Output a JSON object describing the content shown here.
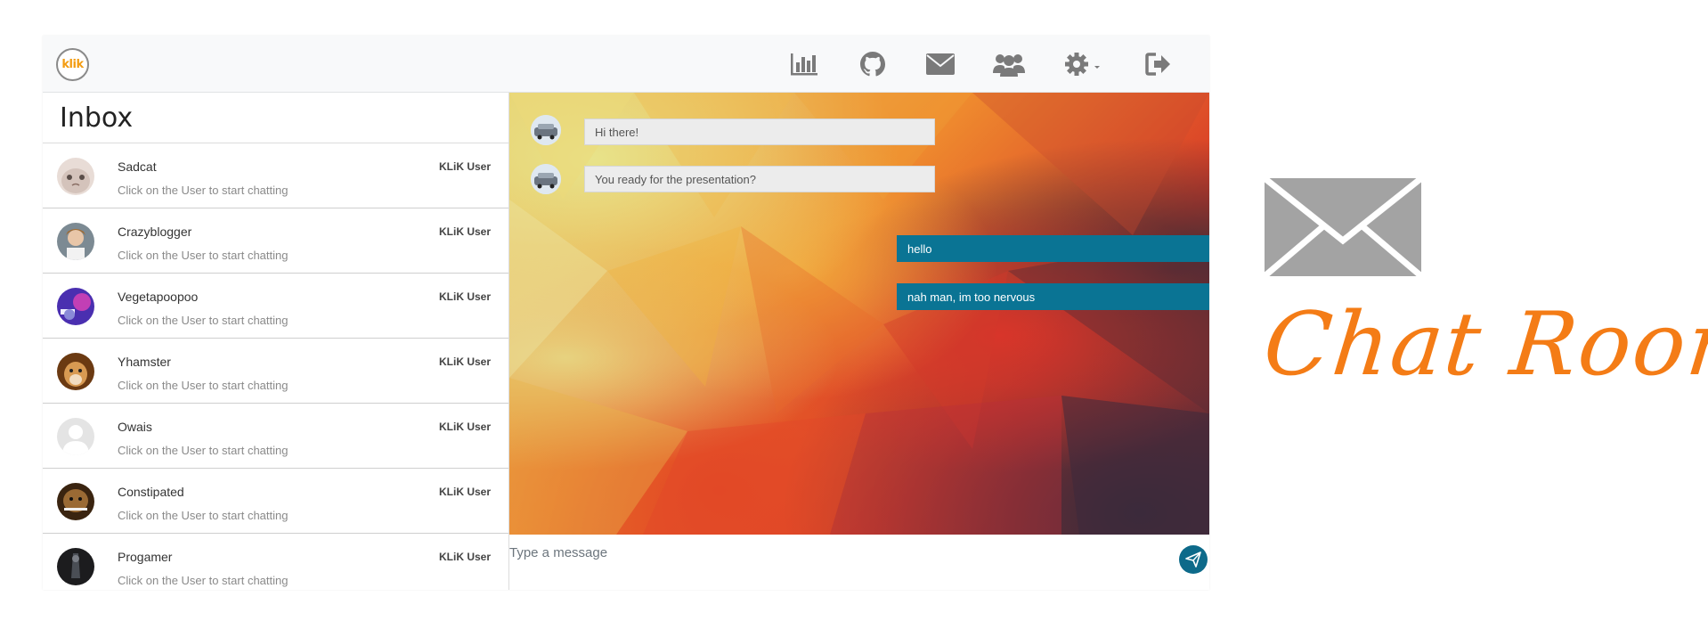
{
  "app": {
    "logo_text": "klik"
  },
  "topbar": {
    "icons": [
      "bar-chart-icon",
      "github-icon",
      "envelope-icon",
      "users-icon",
      "gear-icon",
      "sign-out-icon"
    ]
  },
  "sidebar": {
    "title": "Inbox",
    "users": [
      {
        "name": "Sadcat",
        "hint": "Click on the User to start chatting",
        "badge": "KLiK User"
      },
      {
        "name": "Crazyblogger",
        "hint": "Click on the User to start chatting",
        "badge": "KLiK User"
      },
      {
        "name": "Vegetapoopoo",
        "hint": "Click on the User to start chatting",
        "badge": "KLiK User"
      },
      {
        "name": "Yhamster",
        "hint": "Click on the User to start chatting",
        "badge": "KLiK User"
      },
      {
        "name": "Owais",
        "hint": "Click on the User to start chatting",
        "badge": "KLiK User"
      },
      {
        "name": "Constipated",
        "hint": "Click on the User to start chatting",
        "badge": "KLiK User"
      },
      {
        "name": "Progamer",
        "hint": "Click on the User to start chatting",
        "badge": "KLiK User"
      }
    ]
  },
  "chat": {
    "messages": [
      {
        "direction": "incoming",
        "text": "Hi there!"
      },
      {
        "direction": "incoming",
        "text": "You ready for the presentation?"
      },
      {
        "direction": "outgoing",
        "text": "hello"
      },
      {
        "direction": "outgoing",
        "text": "nah man, im too nervous"
      }
    ],
    "composer_placeholder": "Type a message"
  },
  "promo": {
    "title": "Chat Room"
  },
  "colors": {
    "accent": "#0a7494",
    "brand_orange": "#f47c16"
  }
}
